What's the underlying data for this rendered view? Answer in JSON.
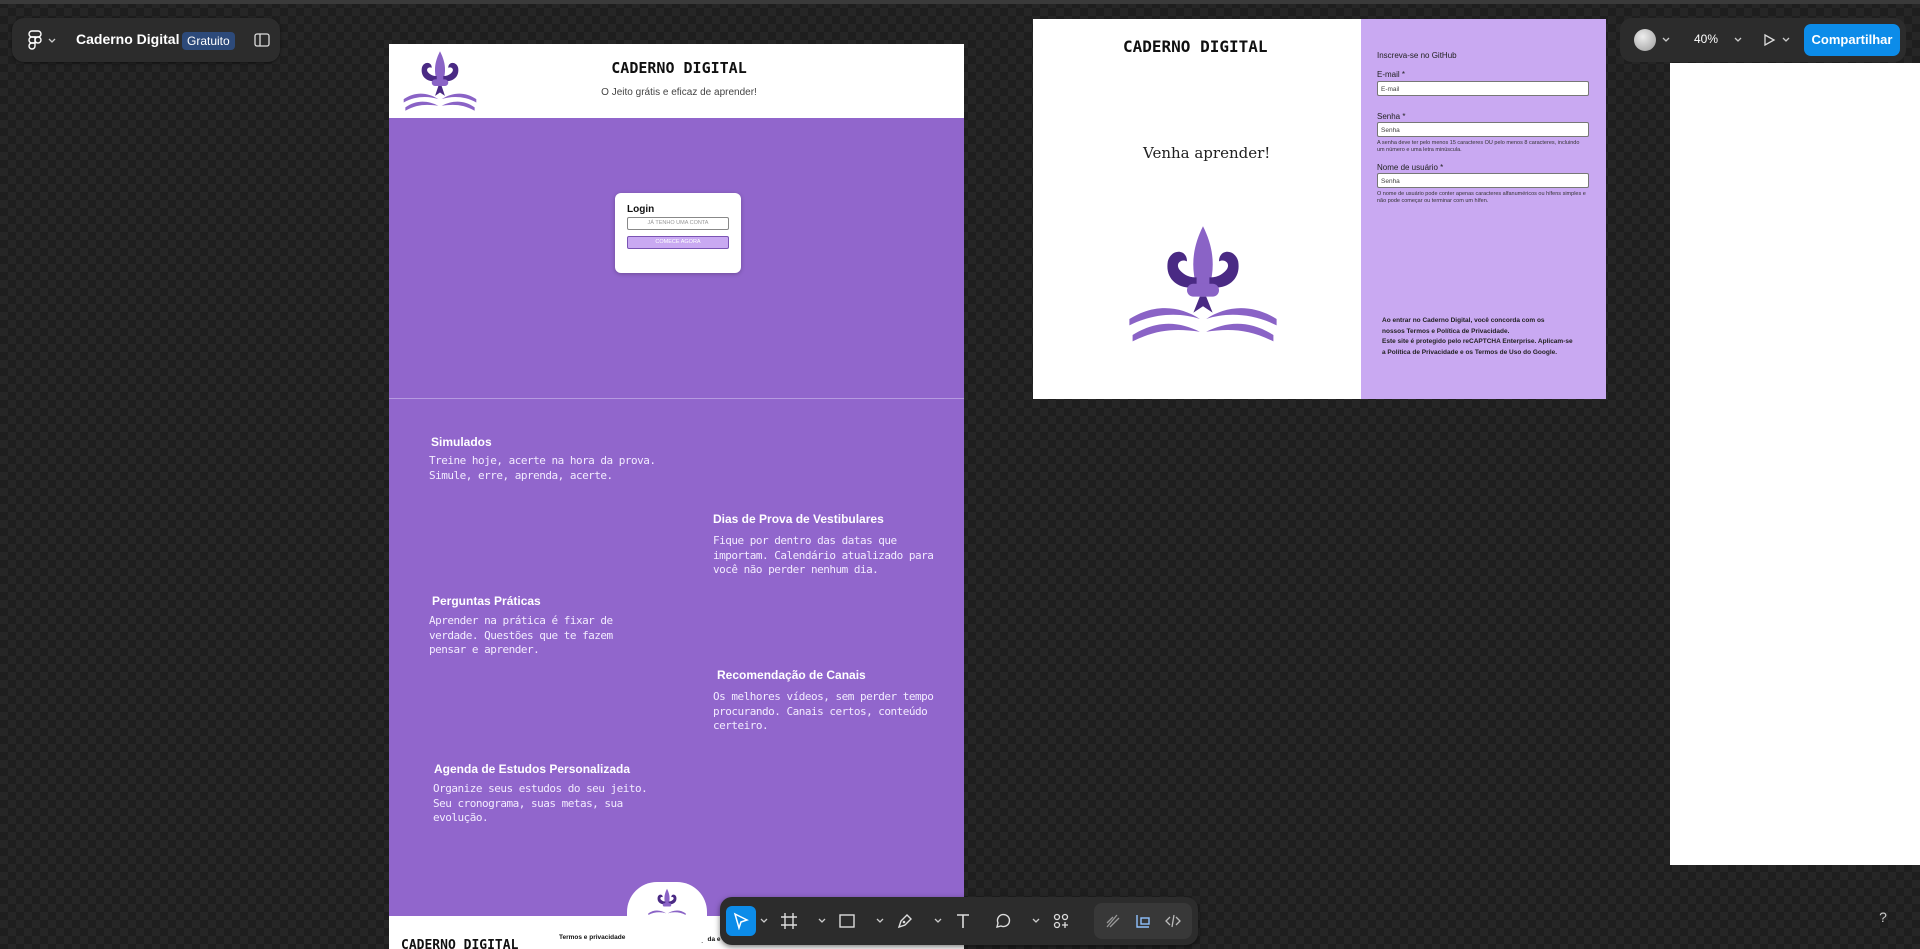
{
  "app": {
    "file_name": "Caderno Digital",
    "plan_badge": "Gratuito"
  },
  "right_toolbar": {
    "zoom": "40%",
    "share_label": "Compartilhar"
  },
  "help": "?",
  "frame_home": {
    "title": "CADERNO DIGITAL",
    "subtitle": "O Jeito grátis e eficaz de aprender!",
    "login": {
      "title": "Login",
      "account_placeholder": "JÁ TENHO UMA CONTA",
      "start_button": "COMECE AGORA"
    },
    "features": [
      {
        "title": "Simulados",
        "lines": [
          "Treine hoje, acerte na hora da prova.",
          "Simule, erre, aprenda, acerte."
        ]
      },
      {
        "title": "Dias de Prova de Vestibulares",
        "lines": [
          "Fique por dentro das datas que",
          "importam. Calendário atualizado para",
          "você não perder nenhum dia."
        ]
      },
      {
        "title": "Perguntas Práticas",
        "lines": [
          "Aprender na prática é fixar de",
          "verdade. Questões que te fazem",
          "pensar e aprender."
        ]
      },
      {
        "title": "Recomendação de Canais",
        "lines": [
          "Os melhores vídeos, sem perder tempo",
          "procurando. Canais certos, conteúdo",
          "certeiro."
        ]
      },
      {
        "title": "Agenda de Estudos Personalizada",
        "lines": [
          "Organize seus estudos do seu jeito.",
          "Seu cronograma, suas metas, sua",
          "evolução."
        ]
      }
    ],
    "footer": {
      "title": "CADERNO DIGITAL",
      "link1": "Termos e privacidade",
      "link2": "Ajuda e"
    }
  },
  "frame_signup": {
    "title": "CADERNO DIGITAL",
    "tagline": "Venha aprender!",
    "heading": "Inscreva-se no GitHub",
    "email_label": "E-mail *",
    "email_value": "E-mail",
    "password_label": "Senha *",
    "password_value": "Senha",
    "password_hint": "A senha deve ter pelo menos 15 caracteres OU pelo menos 8 caracteres, incluindo um número e uma letra minúscula.",
    "username_label": "Nome de usuário *",
    "username_value": "Senha",
    "username_hint": "O nome de usuário pode conter apenas caracteres alfanuméricos ou hífens simples e não pode começar ou terminar com um hífen.",
    "legal": [
      "Ao entrar no Caderno Digital, você concorda com os",
      "nossos Termos e Política de Privacidade.",
      "Este site é protegido pelo reCAPTCHA Enterprise. Aplicam-se",
      "a Política de Privacidade e os Termos de Uso do Google."
    ]
  },
  "colors": {
    "canvas": "#1e1e1e",
    "purple": "#9166cc",
    "lilac": "#c9a9f2",
    "deep_purple": "#4a2a84",
    "accent_blue": "#0c8ce9"
  }
}
